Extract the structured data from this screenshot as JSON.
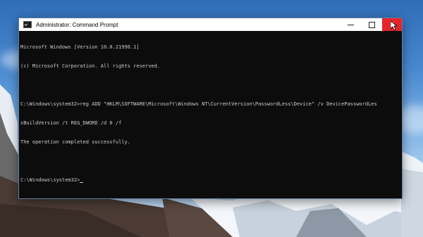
{
  "window": {
    "title": "Administrator: Command Prompt",
    "controls": {
      "minimize": "minimize",
      "maximize": "maximize",
      "close": "✕"
    }
  },
  "console": {
    "lines": [
      "Microsoft Windows [Version 10.0.21996.1]",
      "(c) Microsoft Corporation. All rights reserved.",
      "",
      "C:\\Windows\\system32>reg ADD \"HKLM\\SOFTWARE\\Microsoft\\Windows NT\\CurrentVersion\\PasswordLess\\Device\" /v DevicePasswordLes",
      "sBuildVersion /t REG_DWORD /d 0 /f",
      "The operation completed successfully.",
      "",
      "C:\\Windows\\system32>"
    ]
  },
  "icons": [
    "cmd-app-icon",
    "minimize-icon",
    "maximize-icon",
    "close-icon",
    "mouse-pointer-icon"
  ],
  "colors": {
    "console_bg": "#0c0c0c",
    "console_text": "#cccccc",
    "close_button": "#e5252a"
  }
}
